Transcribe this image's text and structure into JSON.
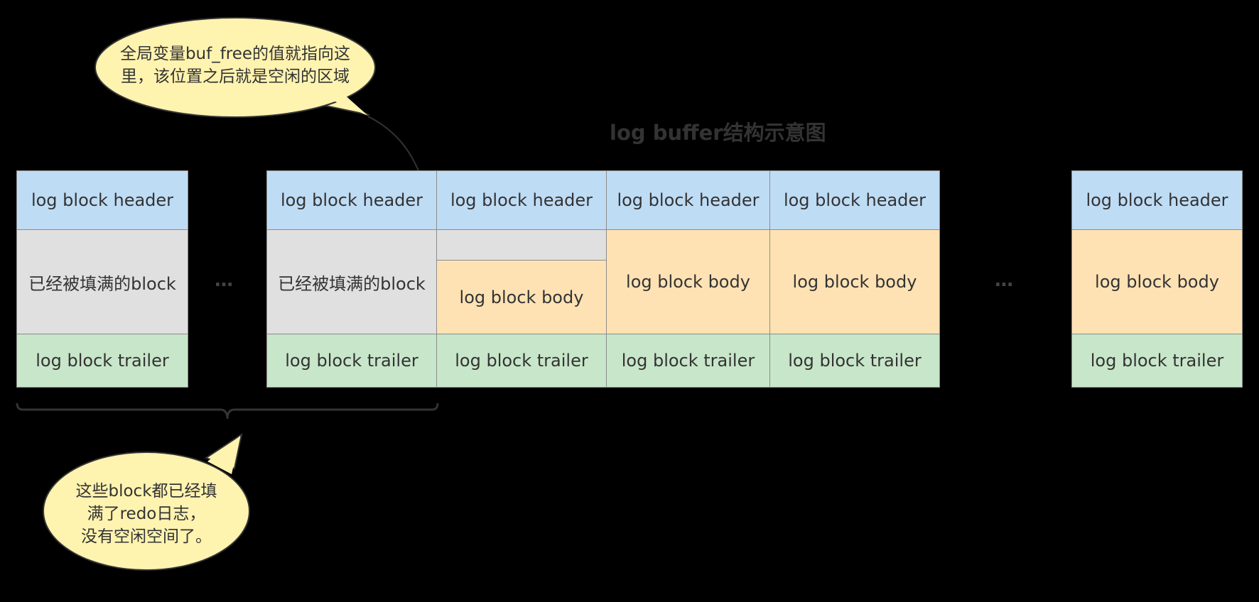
{
  "title": "log buffer结构示意图",
  "header_label": "log block header",
  "trailer_label": "log block trailer",
  "body_label": "log block body",
  "filled_label": "已经被填满的block",
  "ellipsis": "…",
  "callout_top": {
    "line1": "全局变量buf_free的值就指向这",
    "line2": "里，该位置之后就是空闲的区域"
  },
  "callout_bottom": {
    "line1": "这些block都已经填",
    "line2": "满了redo日志，",
    "line3": "没有空闲空间了。"
  },
  "colors": {
    "header": "#bfdcf5",
    "filled": "#e0e0e0",
    "body": "#ffe2b4",
    "trailer": "#c8e6c9",
    "callout": "#fff3b0"
  }
}
